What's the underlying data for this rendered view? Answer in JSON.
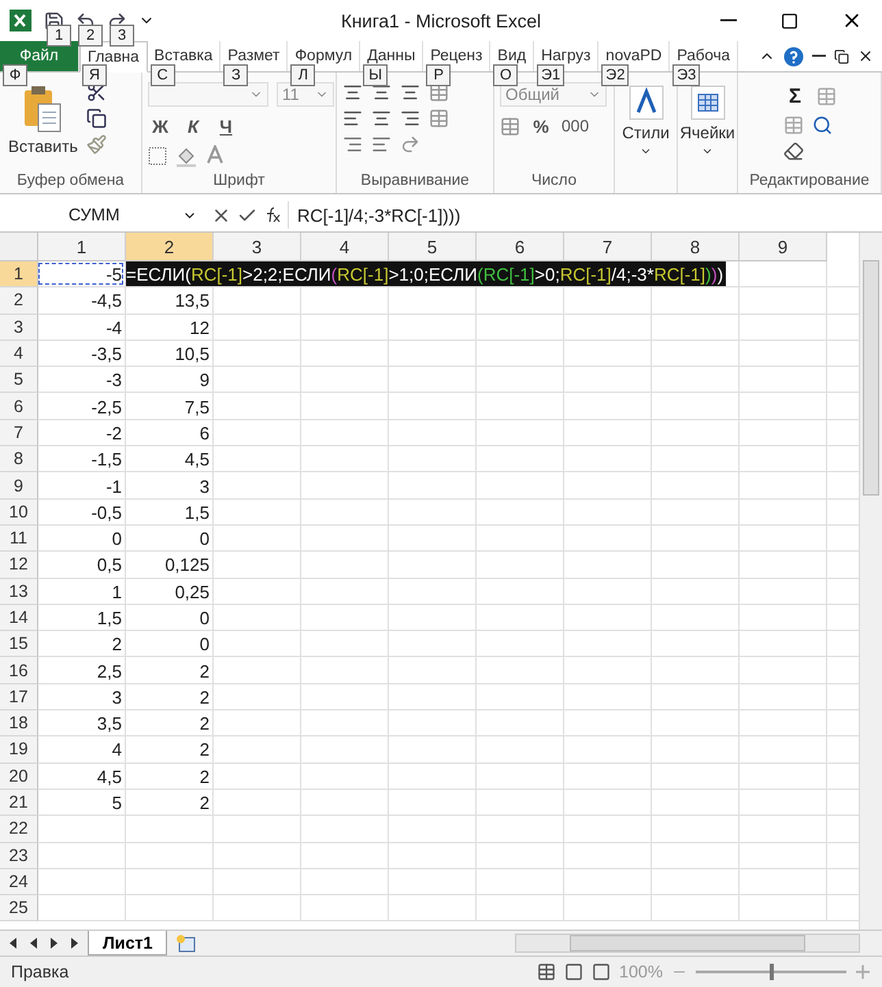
{
  "window": {
    "title": "Книга1  -  Microsoft Excel"
  },
  "quick_access_keytips": [
    "1",
    "2",
    "3"
  ],
  "ribbon_tabs": [
    {
      "label": "Файл",
      "kind": "file",
      "selected": false,
      "keytip": "Ф"
    },
    {
      "label": "Главна",
      "kind": "tab",
      "selected": true,
      "keytip": "Я"
    },
    {
      "label": "Вставка",
      "kind": "tab",
      "selected": false,
      "keytip": "С"
    },
    {
      "label": "Размет",
      "kind": "tab",
      "selected": false,
      "keytip": "З"
    },
    {
      "label": "Формул",
      "kind": "tab",
      "selected": false,
      "keytip": "Л"
    },
    {
      "label": "Данны",
      "kind": "tab",
      "selected": false,
      "keytip": "Ы"
    },
    {
      "label": "Реценз",
      "kind": "tab",
      "selected": false,
      "keytip": "Р"
    },
    {
      "label": "Вид",
      "kind": "tab",
      "selected": false,
      "keytip": "О"
    },
    {
      "label": "Нагруз",
      "kind": "tab",
      "selected": false,
      "keytip": "Э1"
    },
    {
      "label": "novaPD",
      "kind": "tab",
      "selected": false,
      "keytip": "Э2"
    },
    {
      "label": "Рабоча",
      "kind": "tab",
      "selected": false,
      "keytip": "Э3"
    }
  ],
  "ribbon_groups": {
    "clipboard": {
      "label": "Буфер обмена",
      "paste": "Вставить"
    },
    "font": {
      "label": "Шрифт",
      "size": "11",
      "bold": "Ж",
      "italic": "К",
      "underline": "Ч"
    },
    "alignment": {
      "label": "Выравнивание"
    },
    "number": {
      "label": "Число",
      "format": "Общий",
      "percent": "%",
      "thousands": "000"
    },
    "styles": {
      "label": "Стили"
    },
    "cells": {
      "label": "Ячейки"
    },
    "editing": {
      "label": "Редактирование",
      "sum": "Σ"
    }
  },
  "formula_bar": {
    "name_box": "СУММ",
    "formula": "RC[-1]/4;-3*RC[-1])))"
  },
  "columns": [
    {
      "label": "1",
      "selected": false
    },
    {
      "label": "2",
      "selected": true
    },
    {
      "label": "3",
      "selected": false
    },
    {
      "label": "4",
      "selected": false
    },
    {
      "label": "5",
      "selected": false
    },
    {
      "label": "6",
      "selected": false
    },
    {
      "label": "7",
      "selected": false
    },
    {
      "label": "8",
      "selected": false
    },
    {
      "label": "9",
      "selected": false
    }
  ],
  "edit_formula": [
    {
      "text": "=ЕСЛИ(",
      "color": "#ffffff"
    },
    {
      "text": "RC[-1]",
      "color": "#c8c832"
    },
    {
      "text": ">2;2;ЕСЛИ",
      "color": "#ffffff"
    },
    {
      "text": "(",
      "color": "#c050c0"
    },
    {
      "text": "RC[-1]",
      "color": "#c8c832"
    },
    {
      "text": ">1;0;ЕСЛИ",
      "color": "#ffffff"
    },
    {
      "text": "(",
      "color": "#40c040"
    },
    {
      "text": "RC[-1]",
      "color": "#40c040"
    },
    {
      "text": ">0;",
      "color": "#ffffff"
    },
    {
      "text": "RC[-1]",
      "color": "#c8c832"
    },
    {
      "text": "/4;-3*",
      "color": "#ffffff"
    },
    {
      "text": "RC[-1]",
      "color": "#c8c832"
    },
    {
      "text": ")",
      "color": "#40c040"
    },
    {
      "text": ")",
      "color": "#c050c0"
    },
    {
      "text": ")",
      "color": "#ffffff"
    }
  ],
  "rows": [
    {
      "label": "1",
      "selected": true,
      "cells": [
        "-5"
      ]
    },
    {
      "label": "2",
      "selected": false,
      "cells": [
        "-4,5",
        "13,5"
      ]
    },
    {
      "label": "3",
      "selected": false,
      "cells": [
        "-4",
        "12"
      ]
    },
    {
      "label": "4",
      "selected": false,
      "cells": [
        "-3,5",
        "10,5"
      ]
    },
    {
      "label": "5",
      "selected": false,
      "cells": [
        "-3",
        "9"
      ]
    },
    {
      "label": "6",
      "selected": false,
      "cells": [
        "-2,5",
        "7,5"
      ]
    },
    {
      "label": "7",
      "selected": false,
      "cells": [
        "-2",
        "6"
      ]
    },
    {
      "label": "8",
      "selected": false,
      "cells": [
        "-1,5",
        "4,5"
      ]
    },
    {
      "label": "9",
      "selected": false,
      "cells": [
        "-1",
        "3"
      ]
    },
    {
      "label": "10",
      "selected": false,
      "cells": [
        "-0,5",
        "1,5"
      ]
    },
    {
      "label": "11",
      "selected": false,
      "cells": [
        "0",
        "0"
      ]
    },
    {
      "label": "12",
      "selected": false,
      "cells": [
        "0,5",
        "0,125"
      ]
    },
    {
      "label": "13",
      "selected": false,
      "cells": [
        "1",
        "0,25"
      ]
    },
    {
      "label": "14",
      "selected": false,
      "cells": [
        "1,5",
        "0"
      ]
    },
    {
      "label": "15",
      "selected": false,
      "cells": [
        "2",
        "0"
      ]
    },
    {
      "label": "16",
      "selected": false,
      "cells": [
        "2,5",
        "2"
      ]
    },
    {
      "label": "17",
      "selected": false,
      "cells": [
        "3",
        "2"
      ]
    },
    {
      "label": "18",
      "selected": false,
      "cells": [
        "3,5",
        "2"
      ]
    },
    {
      "label": "19",
      "selected": false,
      "cells": [
        "4",
        "2"
      ]
    },
    {
      "label": "20",
      "selected": false,
      "cells": [
        "4,5",
        "2"
      ]
    },
    {
      "label": "21",
      "selected": false,
      "cells": [
        "5",
        "2"
      ]
    },
    {
      "label": "22",
      "selected": false,
      "cells": []
    },
    {
      "label": "23",
      "selected": false,
      "cells": []
    },
    {
      "label": "24",
      "selected": false,
      "cells": []
    },
    {
      "label": "25",
      "selected": false,
      "cells": []
    }
  ],
  "sheet_tabs": [
    {
      "label": "Лист1",
      "selected": true
    }
  ],
  "status_bar": {
    "mode": "Правка",
    "zoom": "100%",
    "zoom_slider": {
      "level": 0.5
    }
  }
}
